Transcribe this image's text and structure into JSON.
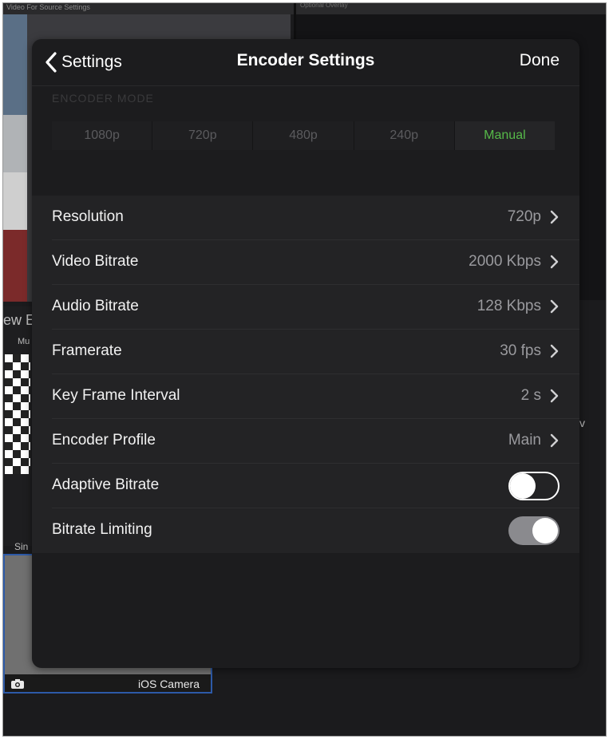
{
  "background": {
    "top_left_text": "Video For Source Settings",
    "top_right_text": "Optional Overlay",
    "side_label_1": "ew E",
    "side_label_2": "Mu",
    "side_label_3": "Sin",
    "bottom_source_label": "iOS Camera",
    "right_text": "v"
  },
  "navbar": {
    "back_label": "Settings",
    "title": "Encoder Settings",
    "done_label": "Done"
  },
  "encoder_mode": {
    "header": "ENCODER MODE",
    "options": [
      "1080p",
      "720p",
      "480p",
      "240p",
      "Manual"
    ],
    "selected": "Manual",
    "selected_color": "#56b949"
  },
  "settings": [
    {
      "label": "Resolution",
      "value": "720p"
    },
    {
      "label": "Video Bitrate",
      "value": "2000 Kbps"
    },
    {
      "label": "Audio Bitrate",
      "value": "128 Kbps"
    },
    {
      "label": "Framerate",
      "value": "30 fps"
    },
    {
      "label": "Key Frame Interval",
      "value": "2 s"
    },
    {
      "label": "Encoder Profile",
      "value": "Main"
    }
  ],
  "toggles": [
    {
      "label": "Adaptive Bitrate",
      "on": false
    },
    {
      "label": "Bitrate Limiting",
      "on": true
    }
  ],
  "icons": {
    "back": "chevron-left-icon",
    "row_disclosure": "chevron-right-icon",
    "camera": "camera-icon"
  }
}
